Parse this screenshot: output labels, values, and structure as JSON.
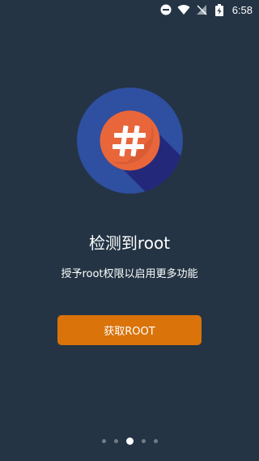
{
  "status_bar": {
    "time": "6:58",
    "icons": [
      "do-not-disturb-icon",
      "wifi-icon",
      "no-signal-icon",
      "battery-charging-icon"
    ]
  },
  "hero": {
    "icon": "hash-icon",
    "colors": {
      "outer": "#2f4fa0",
      "inner": "#e8663a",
      "shadow": "#23287a"
    }
  },
  "main": {
    "title": "检测到root",
    "subtitle": "授予root权限以启用更多功能"
  },
  "action": {
    "button_label": "获取ROOT",
    "color": "#d9730a"
  },
  "pager": {
    "count": 5,
    "active_index": 2
  }
}
